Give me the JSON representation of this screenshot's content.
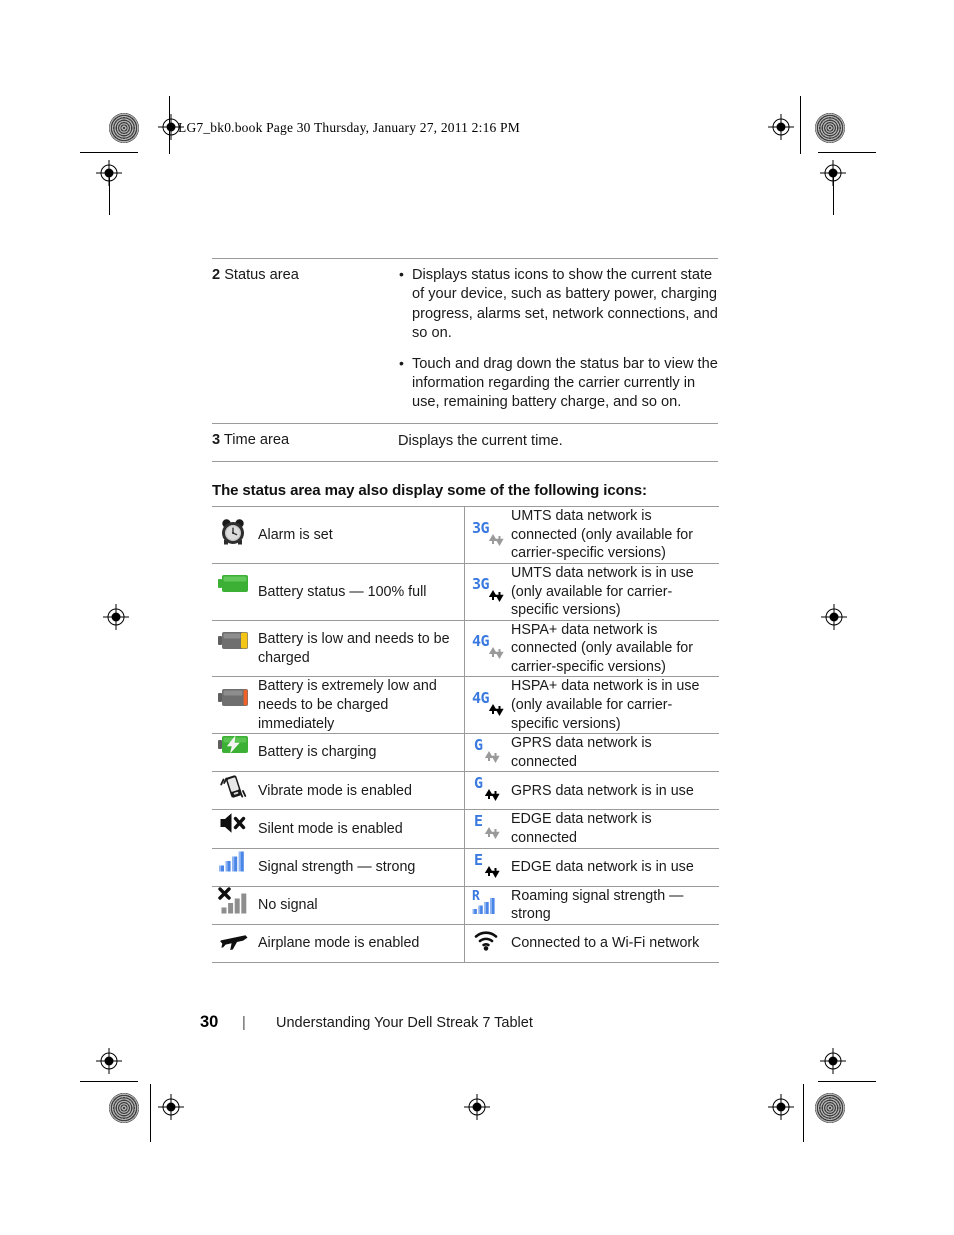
{
  "book_header": "LG7_bk0.book  Page 30  Thursday, January 27, 2011  2:16 PM",
  "top_table": {
    "rows": [
      {
        "index": "2",
        "label": "Status area",
        "bullets": [
          "Displays status icons to show the current state of your device, such as battery power, charging progress, alarms set, network connections, and so on.",
          "Touch and drag down the status bar to view the information regarding the carrier currently in use, remaining battery charge, and so on."
        ]
      },
      {
        "index": "3",
        "label": "Time area",
        "description": "Displays the current time."
      }
    ]
  },
  "section_heading": "The status area may also display some of the following icons:",
  "icon_table": {
    "rows": [
      {
        "left": {
          "icon": "alarm-clock-icon",
          "text": "Alarm is set"
        },
        "right": {
          "icon": "3g-connected-icon",
          "text": "UMTS data network is connected (only available for carrier-specific versions)"
        }
      },
      {
        "left": {
          "icon": "battery-full-icon",
          "text": "Battery status — 100% full"
        },
        "right": {
          "icon": "3g-in-use-icon",
          "text": "UMTS data network is in use (only available for carrier-specific versions)"
        }
      },
      {
        "left": {
          "icon": "battery-low-icon",
          "text": "Battery is low and needs to be charged"
        },
        "right": {
          "icon": "4g-connected-icon",
          "text": "HSPA+ data network is connected (only available for carrier-specific versions)"
        }
      },
      {
        "left": {
          "icon": "battery-critical-icon",
          "text": "Battery is extremely low and needs to be charged immediately"
        },
        "right": {
          "icon": "4g-in-use-icon",
          "text": "HSPA+ data network is in use (only available for carrier-specific versions)"
        }
      },
      {
        "left": {
          "icon": "battery-charging-icon",
          "text": "Battery is charging"
        },
        "right": {
          "icon": "gprs-connected-icon",
          "text": "GPRS data network is connected"
        }
      },
      {
        "left": {
          "icon": "vibrate-mode-icon",
          "text": "Vibrate mode is enabled"
        },
        "right": {
          "icon": "gprs-in-use-icon",
          "text": "GPRS data network is in use"
        }
      },
      {
        "left": {
          "icon": "silent-mode-icon",
          "text": "Silent mode is enabled"
        },
        "right": {
          "icon": "edge-connected-icon",
          "text": "EDGE data network is connected"
        }
      },
      {
        "left": {
          "icon": "signal-strong-icon",
          "text": "Signal strength — strong"
        },
        "right": {
          "icon": "edge-in-use-icon",
          "text": "EDGE data network is in use"
        }
      },
      {
        "left": {
          "icon": "no-signal-icon",
          "text": "No signal"
        },
        "right": {
          "icon": "roaming-signal-icon",
          "text": "Roaming signal strength — strong"
        }
      },
      {
        "left": {
          "icon": "airplane-mode-icon",
          "text": "Airplane mode is enabled"
        },
        "right": {
          "icon": "wifi-connected-icon",
          "text": "Connected to a Wi-Fi network"
        }
      }
    ]
  },
  "footer": {
    "page_number": "30",
    "separator": "|",
    "chapter_title": "Understanding Your Dell Streak 7 Tablet"
  },
  "colors": {
    "network_blue": "#3a7ae0",
    "battery_green": "#3cb034",
    "battery_yellow": "#f5c518",
    "battery_orange": "#f0622a",
    "battery_grey": "#6f6f6f",
    "signal_blue": "#4a86e8",
    "signal_grey": "#9a9a9a",
    "arrow_grey": "#9a9a9a",
    "arrow_black": "#000000",
    "rule_grey": "#9b9b9b"
  }
}
